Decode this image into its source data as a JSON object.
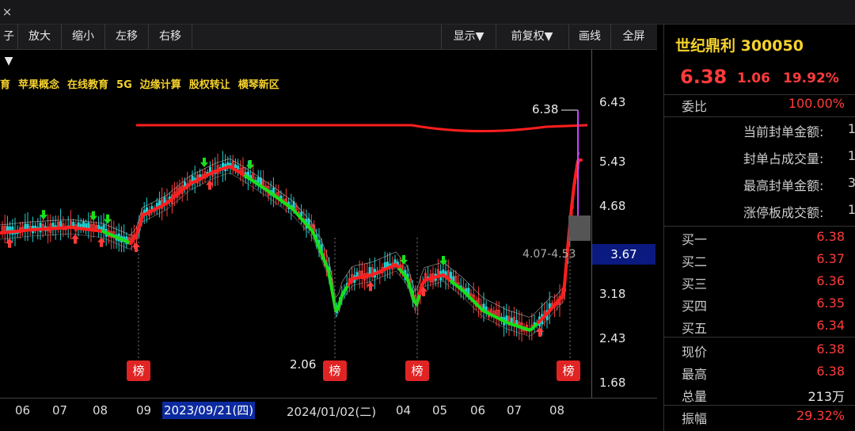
{
  "window": {
    "close_glyph": "×"
  },
  "toolbar": {
    "partial_left": "子▼",
    "zoom_in": "放大",
    "zoom_out": "缩小",
    "move_left": "左移",
    "move_right": "右移",
    "display": "显示▼",
    "adjust": "前复权▼",
    "draw": "画线",
    "fullscreen": "全屏"
  },
  "concepts": [
    "育",
    "苹果概念",
    "在线教育",
    "5G",
    "边缘计算",
    "股权转让",
    "横琴新区"
  ],
  "y_axis_labels": [
    "6.43",
    "5.43",
    "4.68",
    "3.18",
    "2.43",
    "1.68"
  ],
  "current_price_tag": "3.67",
  "range_label": "4.07-4.53",
  "max_label": "6.38",
  "min_label": "2.06",
  "bang_label": "榜",
  "x_axis": {
    "labels": [
      "06",
      "07",
      "08",
      "09",
      "2023/09/21(四)",
      "2024/01/02(二)",
      "04",
      "05",
      "06",
      "07",
      "08"
    ]
  },
  "colors": {
    "up": "#ff3b3b",
    "down": "#20d0d0",
    "ma_red": "#ff1e1e",
    "ma_green": "#18e018",
    "accent_yellow": "#f5d22c"
  },
  "quote": {
    "name": "世纪鼎利 300050",
    "price": "6.38",
    "change": "1.06",
    "change_pct": "19.92%",
    "committee_label": "委比",
    "committee_value": "100.00%",
    "seal_rows": [
      {
        "label": "当前封单金额:",
        "value": "1"
      },
      {
        "label": "封单占成交量:",
        "value": "1"
      },
      {
        "label": "最高封单金额:",
        "value": "3"
      },
      {
        "label": "涨停板成交额:",
        "value": "1"
      }
    ],
    "bids": [
      {
        "label": "买一",
        "value": "6.38"
      },
      {
        "label": "买二",
        "value": "6.37"
      },
      {
        "label": "买三",
        "value": "6.36"
      },
      {
        "label": "买四",
        "value": "6.35"
      },
      {
        "label": "买五",
        "value": "6.34"
      }
    ],
    "stats": [
      {
        "label": "现价",
        "value": "6.38"
      },
      {
        "label": "最高",
        "value": "6.38"
      },
      {
        "label": "总量",
        "value": "213万"
      },
      {
        "label": "振幅",
        "value": "29.32%"
      }
    ]
  },
  "chart_data": {
    "type": "candlestick",
    "y_ticks": [
      6.43,
      5.43,
      4.68,
      3.18,
      2.43,
      1.68
    ],
    "ylim": [
      1.68,
      6.43
    ],
    "x_ticks": [
      "06",
      "07",
      "08",
      "09",
      "2023/09/21(四)",
      "2024/01/02(二)",
      "04",
      "05",
      "06",
      "07",
      "08"
    ],
    "annotations": [
      {
        "text": "6.38",
        "kind": "high"
      },
      {
        "text": "2.06",
        "kind": "low"
      },
      {
        "text": "4.07-4.53",
        "kind": "range"
      }
    ]
  }
}
